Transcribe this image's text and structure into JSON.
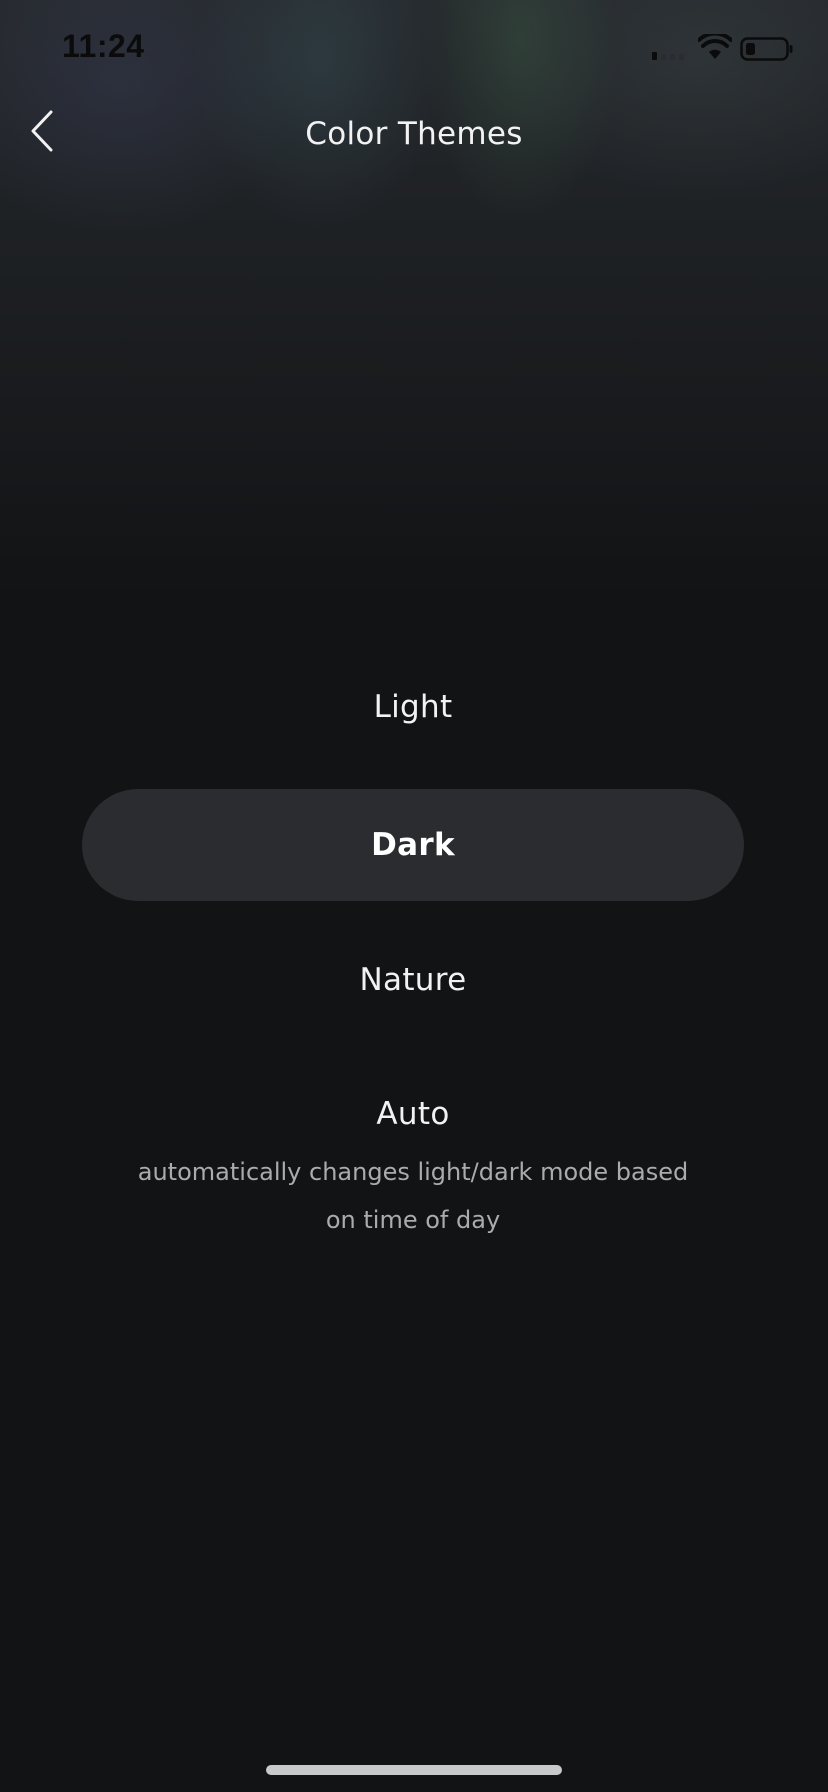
{
  "status_bar": {
    "time": "11:24"
  },
  "nav": {
    "title": "Color Themes",
    "back_icon": "chevron-left-icon"
  },
  "themes": {
    "selected": "Dark",
    "options": [
      {
        "label": "Light"
      },
      {
        "label": "Dark"
      },
      {
        "label": "Nature"
      },
      {
        "label": "Auto",
        "description": "automatically changes light/dark mode based on time of day"
      }
    ]
  },
  "colors": {
    "background": "#121315",
    "selected_pill": "#2a2c2f",
    "primary_text": "#f2f2f2",
    "secondary_text": "#a9abae"
  }
}
